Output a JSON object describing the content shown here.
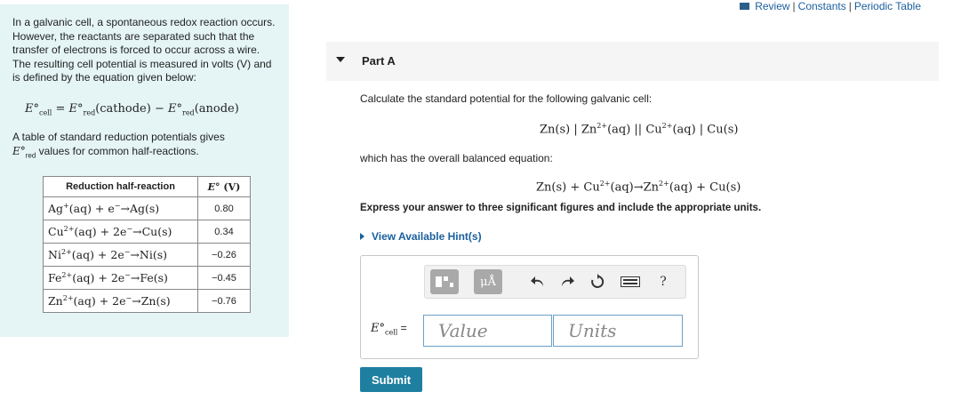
{
  "top_links": {
    "review": "Review",
    "constants": "Constants",
    "periodic_table": "Periodic Table",
    "sep": "|"
  },
  "sidebar": {
    "intro": "In a galvanic cell, a spontaneous redox reaction occurs. However, the reactants are separated such that the transfer of electrons is forced to occur across a wire. The resulting cell potential is measured in volts (V) and is defined by the equation given below:",
    "eq_main": {
      "lhs": "E°",
      "lhs_sub": "cell",
      "eq": " = ",
      "t1": "E°",
      "t1_sub": "red",
      "t1_arg": "(cathode)",
      "minus": " − ",
      "t2": "E°",
      "t2_sub": "red",
      "t2_arg": "(anode)"
    },
    "table_note_line1": "A table of standard reduction potentials gives",
    "table_note_line2_e": "E°",
    "table_note_line2_sub": "red",
    "table_note_line2_rest": " values for common half-reactions.",
    "table_header": {
      "reaction": "Reduction half-reaction",
      "e": "E°",
      "unit": "(V)"
    },
    "rows": [
      {
        "reactant": "Ag",
        "charge": "+",
        "mid": "(aq) + e",
        "esup": "−",
        "arrow": "→",
        "product": "Ag(s)",
        "value": "0.80"
      },
      {
        "reactant": "Cu",
        "charge": "2+",
        "mid": "(aq) + 2e",
        "esup": "−",
        "arrow": "→",
        "product": "Cu(s)",
        "value": "0.34"
      },
      {
        "reactant": "Ni",
        "charge": "2+",
        "mid": "(aq) + 2e",
        "esup": "−",
        "arrow": "→",
        "product": "Ni(s)",
        "value": "−0.26"
      },
      {
        "reactant": "Fe",
        "charge": "2+",
        "mid": "(aq) + 2e",
        "esup": "−",
        "arrow": "→",
        "product": "Fe(s)",
        "value": "−0.45"
      },
      {
        "reactant": "Zn",
        "charge": "2+",
        "mid": "(aq) + 2e",
        "esup": "−",
        "arrow": "→",
        "product": "Zn(s)",
        "value": "−0.76"
      }
    ]
  },
  "part": {
    "title": "Part A"
  },
  "question": {
    "prompt": "Calculate the standard potential for the following galvanic cell:",
    "cell": {
      "a": "Zn(s) | Zn",
      "a_sup": "2+",
      "b": "(aq) || Cu",
      "b_sup": "2+",
      "c": "(aq) | Cu(s)"
    },
    "overall_label": "which has the overall balanced equation:",
    "overall": {
      "a": "Zn(s) + Cu",
      "a_sup": "2+",
      "b": "(aq)→Zn",
      "b_sup": "2+",
      "c": "(aq) + Cu(s)"
    },
    "instruction": "Express your answer to three significant figures and include the appropriate units.",
    "hint": "View Available Hint(s)"
  },
  "answer": {
    "label_e": "E°",
    "label_sub": "cell",
    "label_eq": " =",
    "value_placeholder": "Value",
    "units_placeholder": "Units",
    "toolbar_units_label": "μÅ",
    "submit": "Submit"
  }
}
